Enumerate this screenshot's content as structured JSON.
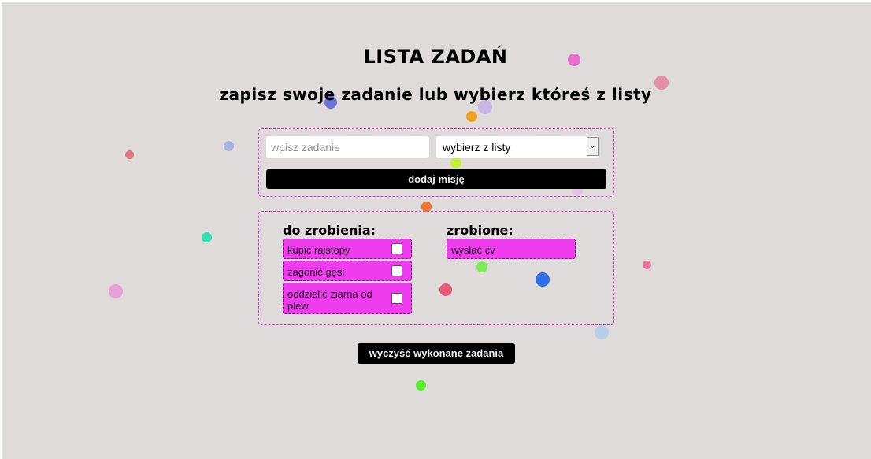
{
  "header": {
    "title": "LISTA ZADAŃ",
    "subtitle": "zapisz swoje zadanie lub wybierz któreś z listy"
  },
  "form": {
    "input_placeholder": "wpisz zadanie",
    "select_value": "wybierz z listy",
    "add_button": "dodaj misję"
  },
  "lists": {
    "todo_title": "do zrobienia:",
    "done_title": "zrobione:",
    "todo": [
      {
        "label": "kupić rajstopy"
      },
      {
        "label": "zagonić gęsi"
      },
      {
        "label": "oddzielić ziarna od plew"
      }
    ],
    "done": [
      {
        "label": "wysłać cv"
      }
    ]
  },
  "footer": {
    "clear_button": "wyczyść wykonane zadania"
  },
  "colors": {
    "background": "#dfdbdb",
    "task_bg": "#ee3cee",
    "panel_border": "#e233c9",
    "button_bg": "#000000"
  }
}
